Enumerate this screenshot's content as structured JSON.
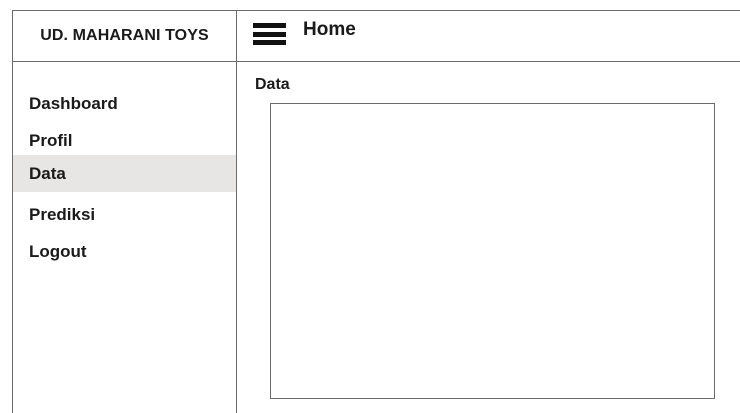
{
  "brand": {
    "name": "UD. MAHARANI TOYS"
  },
  "header": {
    "title": "Home",
    "menu_icon": "hamburger-menu-icon"
  },
  "sidebar": {
    "items": [
      {
        "label": "Dashboard",
        "active": false
      },
      {
        "label": "Profil",
        "active": false
      },
      {
        "label": "Data",
        "active": true
      },
      {
        "label": "Prediksi",
        "active": false
      },
      {
        "label": "Logout",
        "active": false
      }
    ],
    "active_background": "#e7e6e4"
  },
  "main": {
    "section_title": "Data"
  }
}
